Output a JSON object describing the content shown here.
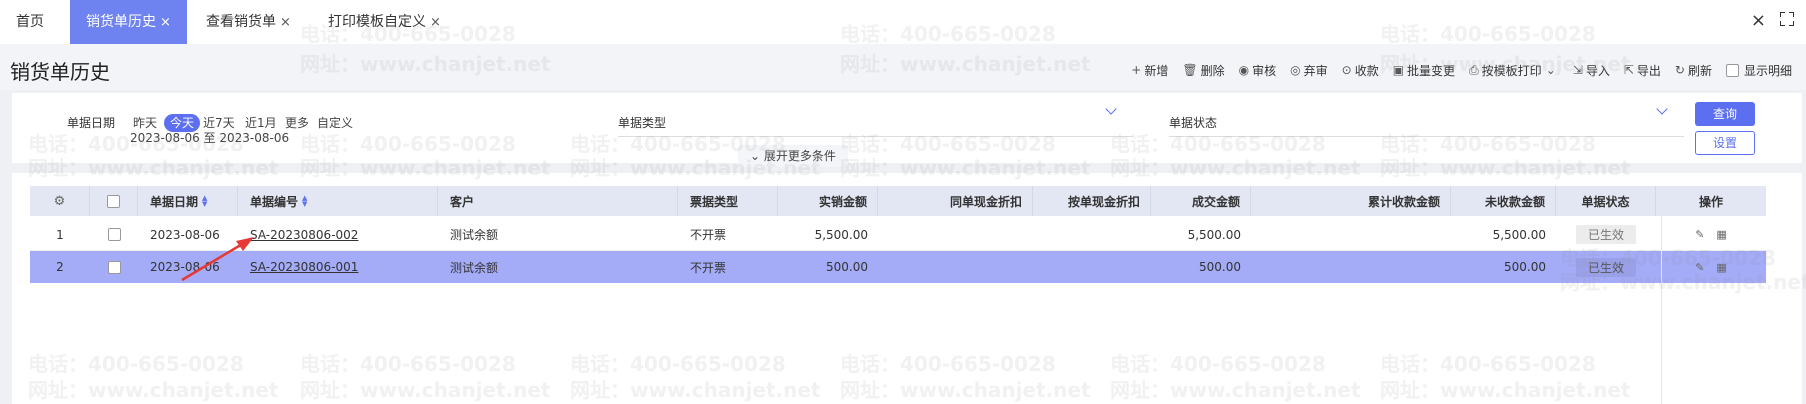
{
  "tabs": [
    {
      "label": "首页",
      "closable": false,
      "active": false
    },
    {
      "label": "销货单历史",
      "closable": true,
      "active": true
    },
    {
      "label": "查看销货单",
      "closable": true,
      "active": false
    },
    {
      "label": "打印模板自定义",
      "closable": true,
      "active": false
    }
  ],
  "close_glyph": "×",
  "page_title": "销货单历史",
  "toolbar": {
    "add": "新增",
    "delete": "删除",
    "audit": "审核",
    "unaudit": "弃审",
    "receive": "收款",
    "batch_change": "批量变更",
    "print_by_template": "按模板打印",
    "import": "导入",
    "export": "导出",
    "refresh": "刷新",
    "show_detail": "显示明细"
  },
  "filter": {
    "date_label": "单据日期",
    "date_options": [
      "昨天",
      "今天",
      "近7天",
      "近1月",
      "更多",
      "自定义"
    ],
    "date_selected": "今天",
    "date_range": "2023-08-06 至 2023-08-06",
    "type_label": "单据类型",
    "status_label": "单据状态",
    "query_button": "查询",
    "settings_button": "设置",
    "expand_label": "展开更多条件"
  },
  "table": {
    "headers": [
      "单据日期",
      "单据编号",
      "客户",
      "票据类型",
      "实销金额",
      "同单现金折扣",
      "按单现金折扣",
      "成交金额",
      "累计收款金额",
      "未收款金额",
      "单据状态",
      "操作"
    ],
    "rows": [
      {
        "index": "1",
        "date": "2023-08-06",
        "number": "SA-20230806-002",
        "customer": "测试余额",
        "invoice_type": "不开票",
        "sales_amount": "5,500.00",
        "same_cash_discount": "",
        "cash_discount": "",
        "deal_amount": "5,500.00",
        "received_total": "",
        "unreceived": "5,500.00",
        "status": "已生效"
      },
      {
        "index": "2",
        "date": "2023-08-06",
        "number": "SA-20230806-001",
        "customer": "测试余额",
        "invoice_type": "不开票",
        "sales_amount": "500.00",
        "same_cash_discount": "",
        "cash_discount": "",
        "deal_amount": "500.00",
        "received_total": "",
        "unreceived": "500.00",
        "status": "已生效"
      }
    ]
  },
  "watermark": {
    "phone": "电话：400-665-0028",
    "site": "网址：www.chanjet.net"
  },
  "colors": {
    "accent": "#5b6ff0",
    "active_tab": "#6f83f0",
    "selected_row": "#a4abf7",
    "header_bg": "#e3e7f4",
    "arrow": "#e53935"
  },
  "icons": {
    "add": "plus-icon",
    "delete": "trash-icon",
    "audit": "audit-icon",
    "unaudit": "unaudit-icon",
    "receive": "receive-icon",
    "batch_change": "batch-icon",
    "print": "printer-icon",
    "import": "import-icon",
    "export": "export-icon",
    "refresh": "refresh-icon",
    "column_settings": "settings-icon",
    "op_edit": "edit-icon",
    "op_qr": "qr-icon"
  }
}
